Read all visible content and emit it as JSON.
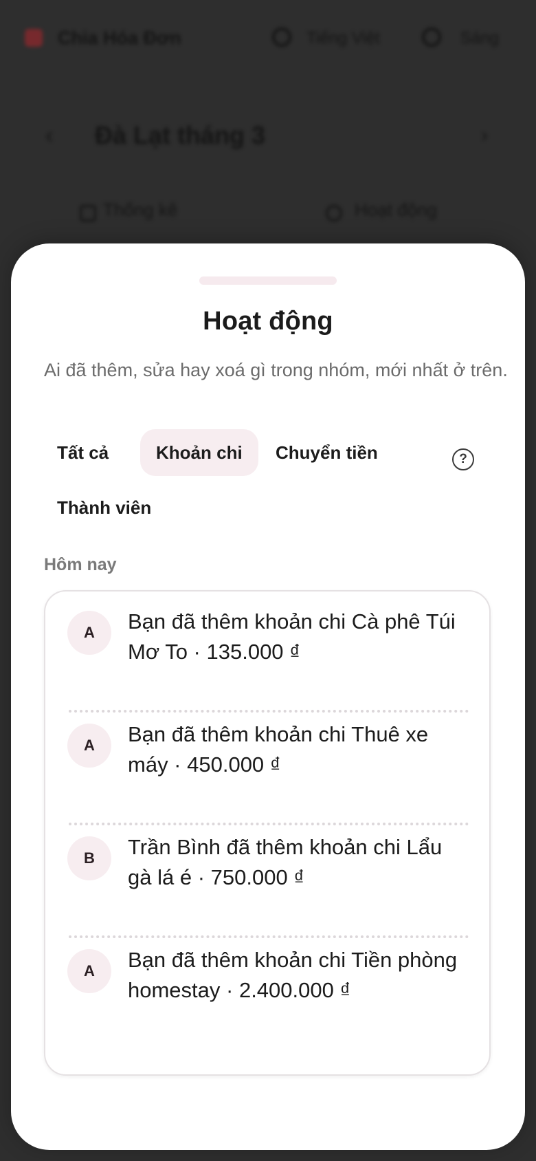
{
  "background_app": {
    "brand_name": "Chia Hóa Đơn",
    "language_label": "Tiếng Việt",
    "theme_label": "Sáng",
    "group_title": "Đà Lạt tháng 3",
    "tabs": [
      {
        "label": "Thống kê"
      },
      {
        "label": "Hoạt động"
      }
    ]
  },
  "sheet": {
    "title": "Hoạt động",
    "description": "Ai đã thêm, sửa hay xoá gì trong nhóm, mới nhất ở trên.",
    "filters": [
      {
        "label": "Tất cả",
        "active": false
      },
      {
        "label": "Khoản chi",
        "active": true
      },
      {
        "label": "Chuyển tiền",
        "active": false
      },
      {
        "label": "Thành viên",
        "active": false
      }
    ],
    "help_icon": "help-circle-icon",
    "help_glyph": "?",
    "section_label": "Hôm nay",
    "activities": [
      {
        "avatar": "A",
        "text": "Bạn đã thêm khoản chi Cà phê Túi Mơ To · 135.000 ₫"
      },
      {
        "avatar": "A",
        "text": "Bạn đã thêm khoản chi Thuê xe máy · 450.000 ₫"
      },
      {
        "avatar": "B",
        "text": "Trần Bình đã thêm khoản chi Lẩu gà lá é · 750.000 ₫"
      },
      {
        "avatar": "A",
        "text": "Bạn đã thêm khoản chi Tiền phòng homestay · 2.400.000 ₫"
      }
    ]
  },
  "colors": {
    "scrim": "#2e2e2e",
    "sheet_bg": "#ffffff",
    "chip_active_bg": "#f7edf0",
    "avatar_bg": "#f7edf0",
    "muted_text": "#6b6b6b",
    "brand": "#b3262d"
  }
}
